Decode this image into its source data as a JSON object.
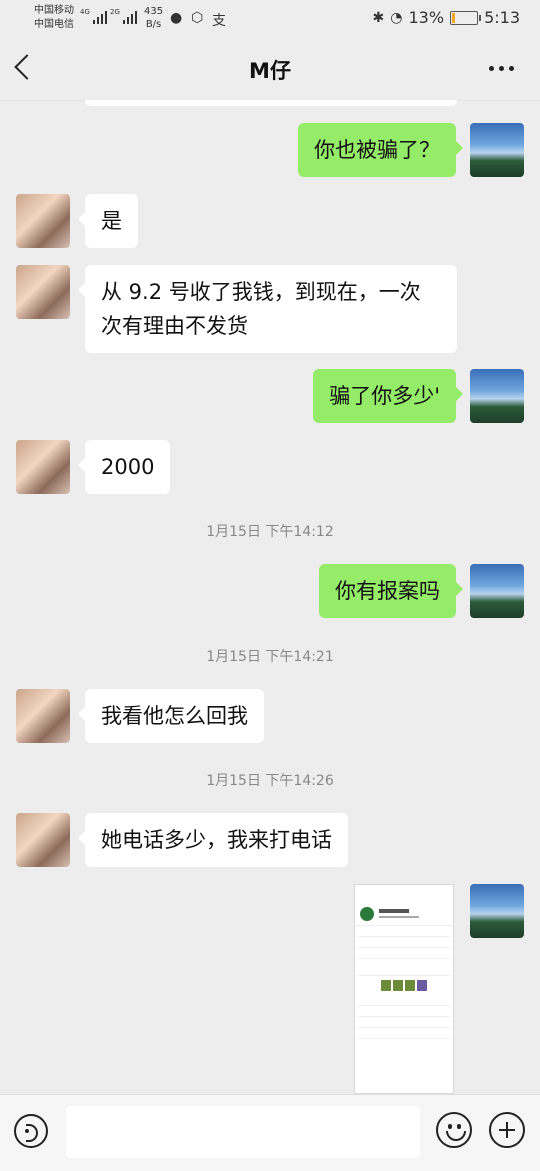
{
  "status_bar": {
    "carrier1": "中国移动",
    "carrier2": "中国电信",
    "net1": "4G",
    "net2": "2G",
    "speed_value": "435",
    "speed_unit": "B/s",
    "battery": "13%",
    "time": "5:13"
  },
  "header": {
    "title": "M仔"
  },
  "messages": [
    {
      "side": "out",
      "text": "你也被骗了？"
    },
    {
      "side": "in",
      "text": "是"
    },
    {
      "side": "in",
      "text": "从 9.2 号收了我钱，到现在，一次\n次有理由不发货"
    },
    {
      "side": "out",
      "text": "骗了你多少'"
    },
    {
      "side": "in",
      "text": "2000"
    },
    {
      "time": "1月15日 下午14:12"
    },
    {
      "side": "out",
      "text": "你有报案吗"
    },
    {
      "time": "1月15日 下午14:21"
    },
    {
      "side": "in",
      "text": "我看他怎么回我"
    },
    {
      "time": "1月15日 下午14:26"
    },
    {
      "side": "in",
      "text": "她电话多少，我来打电话"
    },
    {
      "side": "out",
      "image": "screenshot-thumbnail"
    }
  ],
  "input_bar": {
    "text_value": ""
  },
  "colors": {
    "background": "#ededed",
    "incoming_bubble": "#ffffff",
    "outgoing_bubble": "#95ec69"
  }
}
